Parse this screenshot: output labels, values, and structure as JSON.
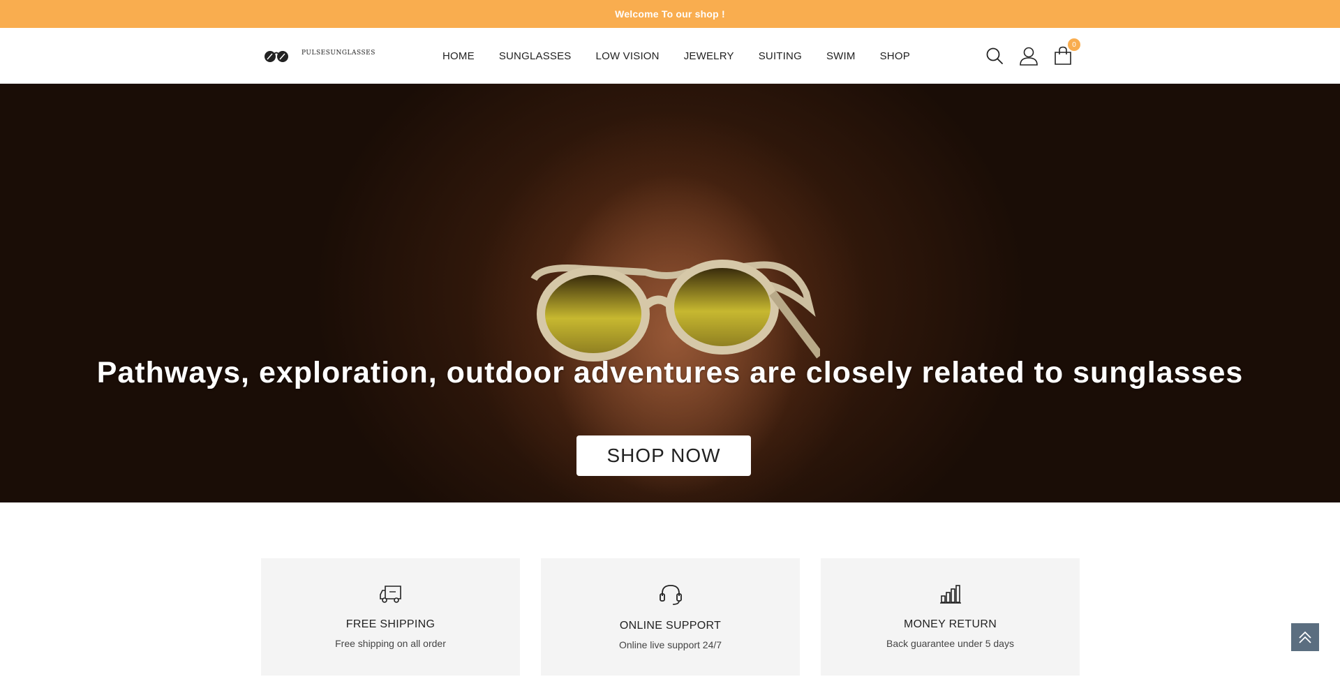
{
  "topbar": {
    "text": "Welcome To our shop !"
  },
  "header": {
    "logo_text": "PULSESUNGLASSES",
    "nav": [
      {
        "label": "HOME"
      },
      {
        "label": "SUNGLASSES"
      },
      {
        "label": "LOW VISION"
      },
      {
        "label": "JEWELRY"
      },
      {
        "label": "SUITING"
      },
      {
        "label": "SWIM"
      },
      {
        "label": "SHOP"
      }
    ],
    "icons": [
      "search-icon",
      "user-icon",
      "bag-icon"
    ],
    "cart_count": "0"
  },
  "hero": {
    "title": "Pathways, exploration, outdoor adventures are closely related to sunglasses",
    "button_label": "SHOP NOW"
  },
  "features": [
    {
      "icon": "truck-icon",
      "title": "FREE SHIPPING",
      "desc": "Free shipping on all order"
    },
    {
      "icon": "headset-icon",
      "title": "ONLINE SUPPORT",
      "desc": "Online live support 24/7"
    },
    {
      "icon": "chart-bars-icon",
      "title": "MONEY RETURN",
      "desc": "Back guarantee under 5 days"
    }
  ],
  "colors": {
    "accent": "#f9ad4f",
    "back_to_top": "#5b6e80"
  }
}
